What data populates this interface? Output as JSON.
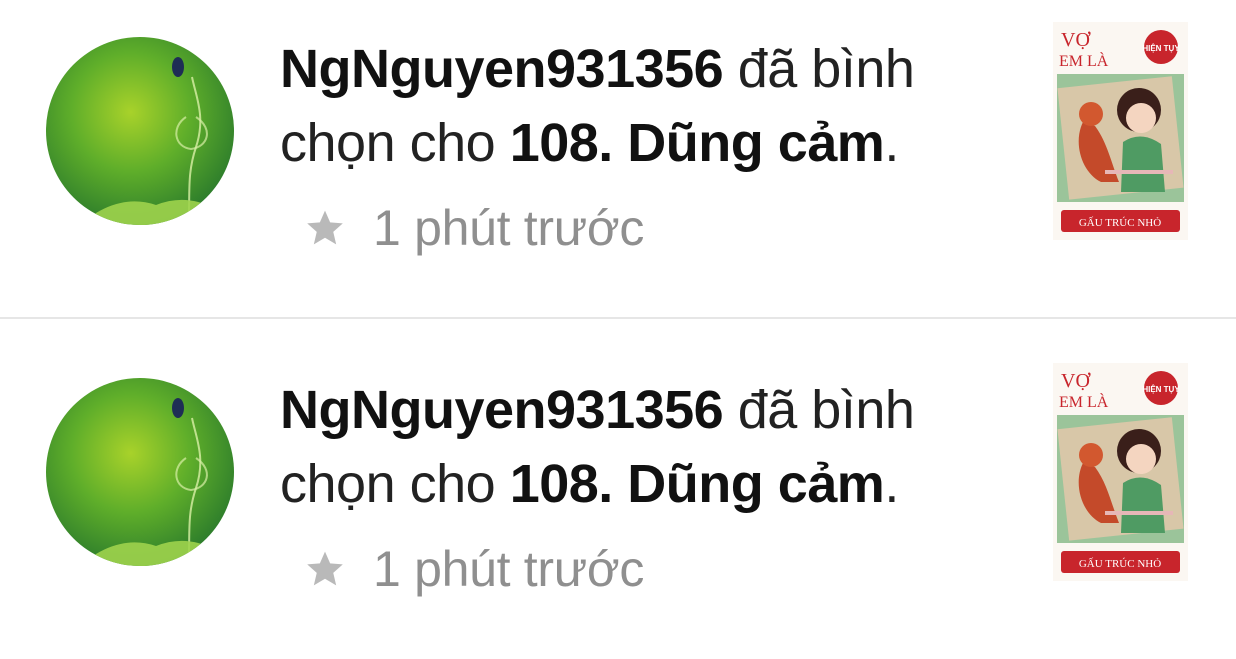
{
  "notifications": [
    {
      "user": "NgNguyen931356",
      "action": "đã bình chọn cho",
      "chapter": "108. Dũng cảm",
      "end_punct": ".",
      "icon": "star-icon",
      "time": "1 phút trước",
      "cover": {
        "title_top": "VỢ",
        "title_mid": "EM LÀ",
        "badge": "HIỆN TỤY",
        "title_bottom": "GẤU TRÚC NHỎ"
      }
    },
    {
      "user": "NgNguyen931356",
      "action": "đã bình chọn cho",
      "chapter": "108. Dũng cảm",
      "end_punct": ".",
      "icon": "star-icon",
      "time": "1 phút trước",
      "cover": {
        "title_top": "VỢ",
        "title_mid": "EM LÀ",
        "badge": "HIỆN TỤY",
        "title_bottom": "GẤU TRÚC NHỎ"
      }
    }
  ],
  "colors": {
    "star": "#b9b9b9",
    "time_text": "#8f8f8f",
    "cover_red": "#c8252c",
    "divider": "#e6e6e6"
  }
}
